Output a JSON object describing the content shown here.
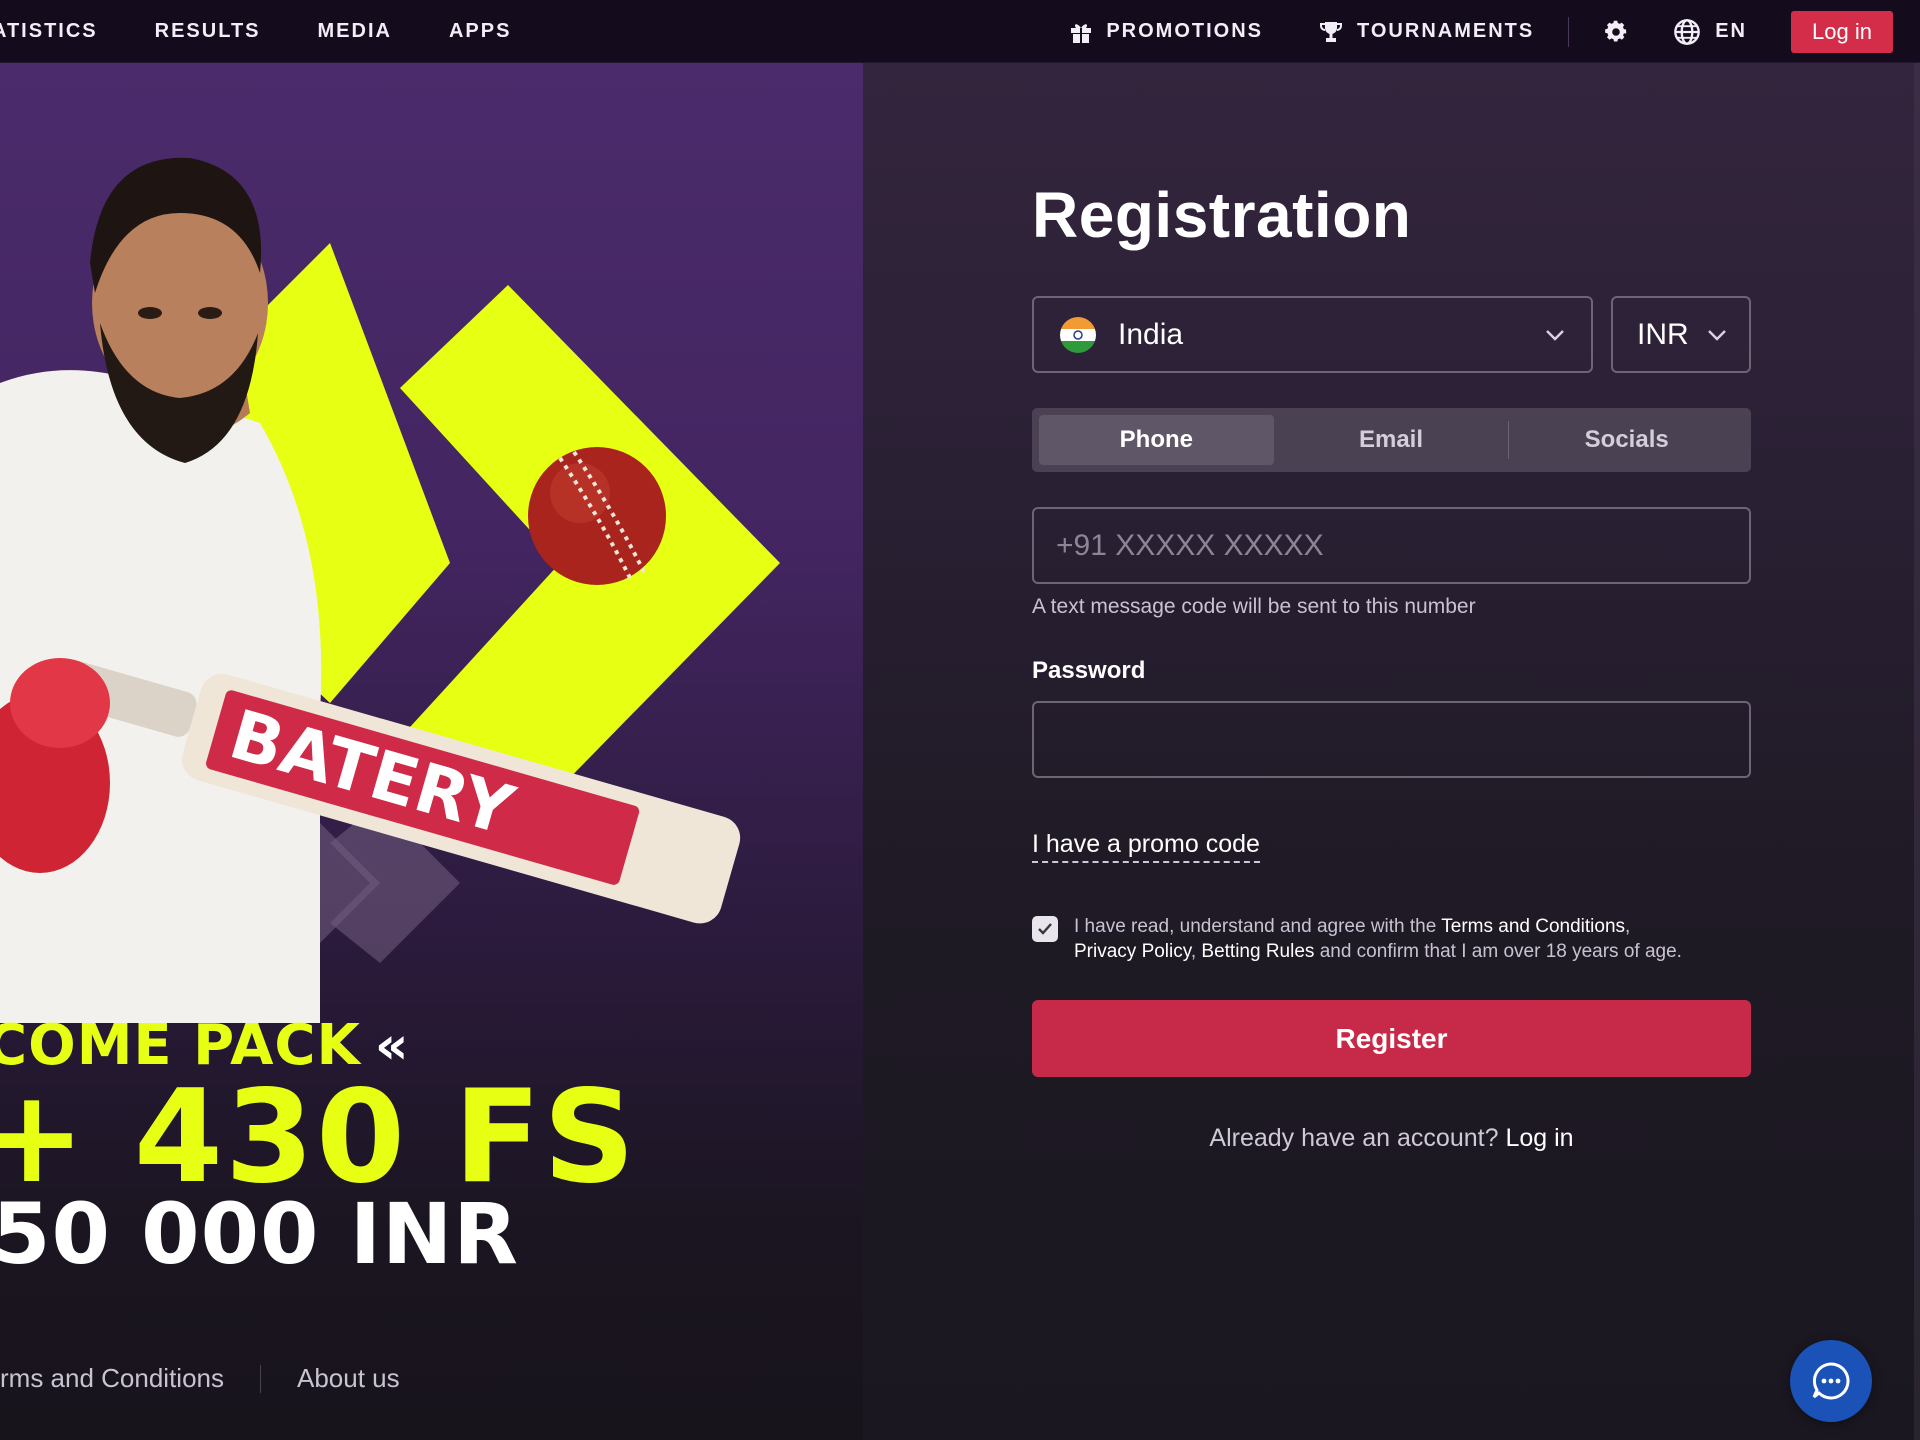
{
  "nav": {
    "left_items": [
      "ATISTICS",
      "RESULTS",
      "MEDIA",
      "APPS"
    ],
    "promotions": "PROMOTIONS",
    "tournaments": "TOURNAMENTS",
    "language": "EN",
    "login": "Log in"
  },
  "promo": {
    "bat_brand": "BATERY",
    "headline": "COME PACK",
    "headline_arrow": "«",
    "free_spins": "+ 430 FS",
    "amount": "50 000 INR",
    "colors": {
      "accent": "#e6ff12",
      "bg_top": "#4b2b6b"
    }
  },
  "footer": {
    "links": [
      "rms and Conditions",
      "About us"
    ]
  },
  "registration": {
    "title": "Registration",
    "country": "India",
    "currency": "INR",
    "tabs": [
      "Phone",
      "Email",
      "Socials"
    ],
    "active_tab": "Phone",
    "phone_placeholder": "+91 XXXXX XXXXX",
    "phone_hint": "A text message code will be sent to this number",
    "password_label": "Password",
    "promo_code_link": "I have a promo code",
    "agree": {
      "prefix": "I have read, understand and agree with the ",
      "terms": "Terms and Conditions",
      "comma1": ",",
      "privacy": "Privacy Policy",
      "comma2": ", ",
      "rules": "Betting Rules",
      "suffix": " and confirm that I am over 18 years of age.",
      "checked": true
    },
    "register_button": "Register",
    "already_text": "Already have an account? ",
    "already_link": "Log in",
    "colors": {
      "primary": "#c72a48",
      "tab_active": "#5f5668"
    }
  },
  "chat": {
    "icon": "chat-bubble-icon",
    "color": "#1b52b8"
  }
}
